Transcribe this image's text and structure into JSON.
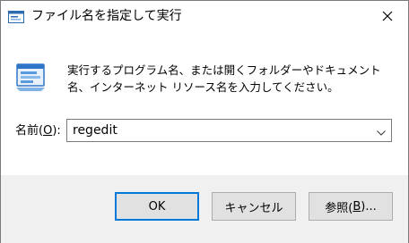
{
  "window": {
    "title": "ファイル名を指定して実行",
    "icon": "run-app-icon",
    "close_icon": "close-icon"
  },
  "content": {
    "icon": "run-dialog-icon",
    "description": "実行するプログラム名、または開くフォルダーやドキュメント名、インターネット リソース名を入力してください。",
    "open_label_prefix": "名前(",
    "open_label_key": "O",
    "open_label_suffix": "):",
    "input_value": "regedit",
    "dropdown_icon": "chevron-down-icon"
  },
  "buttons": {
    "ok_label": "OK",
    "cancel_label": "キャンセル",
    "browse_prefix": "参照(",
    "browse_key": "B",
    "browse_suffix": ")..."
  },
  "colors": {
    "accent": "#0078d7",
    "footer_bg": "#f0f0f0",
    "button_bg": "#e1e1e1"
  }
}
